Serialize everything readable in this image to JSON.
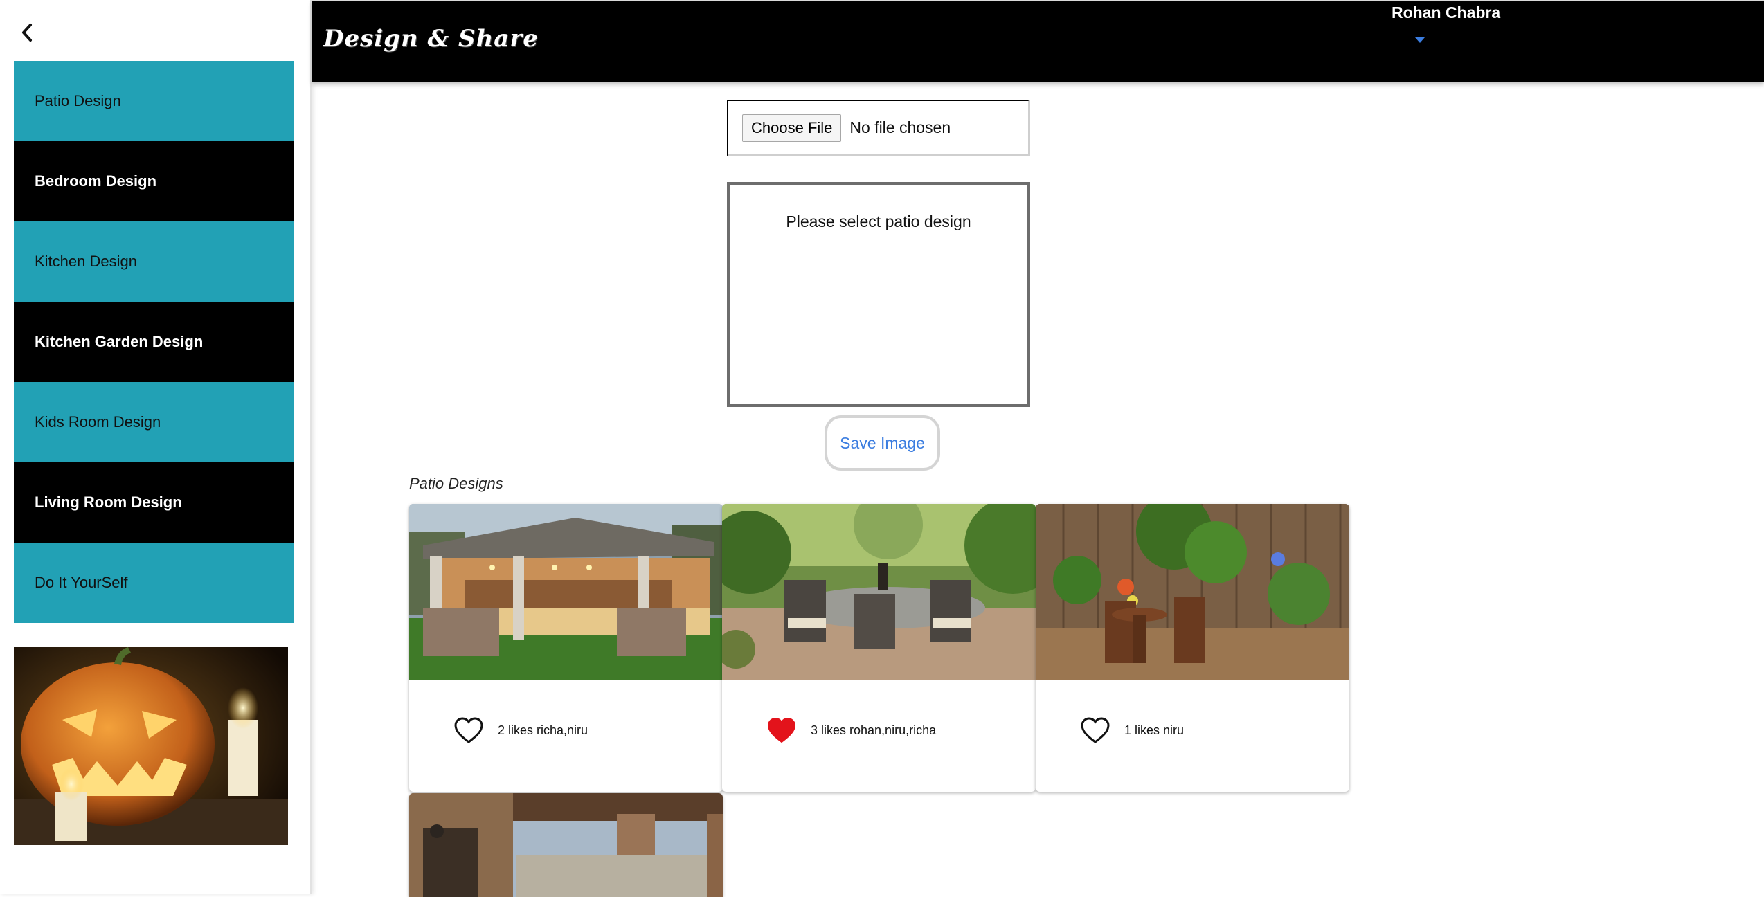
{
  "sidebar": {
    "back_icon": "chevron-left-icon",
    "items": [
      {
        "label": "Patio Design",
        "style": "teal"
      },
      {
        "label": "Bedroom Design",
        "style": "black"
      },
      {
        "label": "Kitchen Design",
        "style": "teal"
      },
      {
        "label": "Kitchen Garden Design",
        "style": "black"
      },
      {
        "label": "Kids Room Design",
        "style": "teal"
      },
      {
        "label": "Living Room Design",
        "style": "black"
      },
      {
        "label": "Do It YourSelf",
        "style": "teal"
      }
    ],
    "promo_image": "halloween-pumpkin-candles"
  },
  "header": {
    "logo": "Design & Share",
    "user_name": "Rohan Chabra",
    "user_menu_icon": "caret-down-icon"
  },
  "upload": {
    "choose_file_label": "Choose File",
    "file_status": "No file chosen",
    "preview_message": "Please select patio design",
    "save_label": "Save Image"
  },
  "gallery": {
    "title": "Patio Designs",
    "cards": [
      {
        "image": "covered-patio-pavilion",
        "liked": false,
        "likes_text": "2 likes richa,niru"
      },
      {
        "image": "patio-dining-set",
        "liked": true,
        "likes_text": "3 likes rohan,niru,richa"
      },
      {
        "image": "garden-bistro-chairs",
        "liked": false,
        "likes_text": "1 likes niru"
      }
    ],
    "partial_card": {
      "image": "stone-porch-pergola"
    }
  },
  "colors": {
    "teal": "#22a1b5",
    "black": "#000000",
    "link_blue": "#3b7de0",
    "heart_red": "#e3131b"
  }
}
